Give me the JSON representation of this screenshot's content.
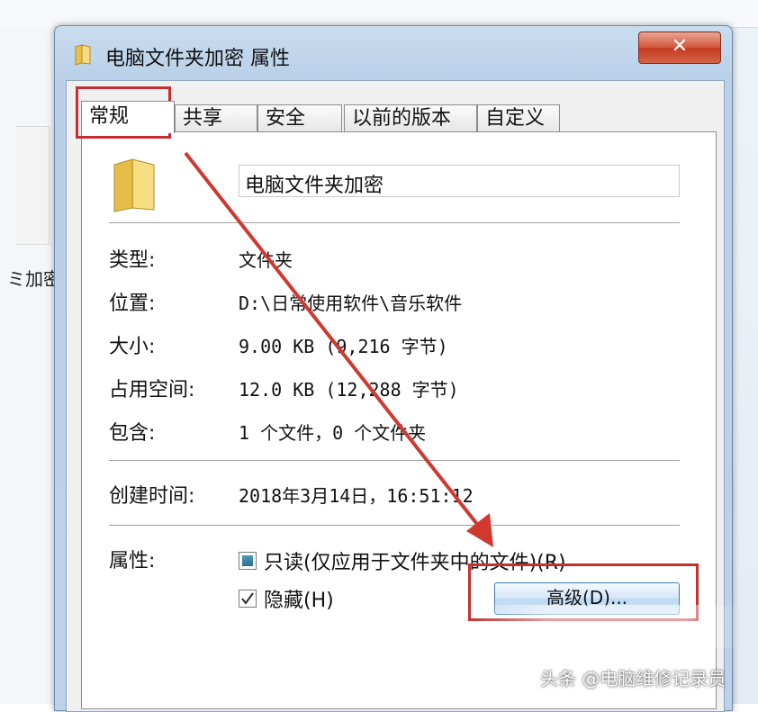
{
  "background": {
    "folder_label": "ミ加密"
  },
  "window": {
    "title": "电脑文件夹加密 属性",
    "close_label": "✕"
  },
  "tabs": [
    {
      "label": "常规",
      "active": true
    },
    {
      "label": "共享",
      "active": false
    },
    {
      "label": "安全",
      "active": false
    },
    {
      "label": "以前的版本",
      "active": false
    },
    {
      "label": "自定义",
      "active": false
    }
  ],
  "general": {
    "folder_name": "电脑文件夹加密",
    "rows": [
      {
        "label": "类型:",
        "value": "文件夹"
      },
      {
        "label": "位置:",
        "value": "D:\\日常使用软件\\音乐软件"
      },
      {
        "label": "大小:",
        "value": "9.00 KB (9,216 字节)"
      },
      {
        "label": "占用空间:",
        "value": "12.0 KB (12,288 字节)"
      },
      {
        "label": "包含:",
        "value": "1 个文件，0 个文件夹"
      }
    ],
    "created_label": "创建时间:",
    "created_value": "2018年3月14日，16:51:12",
    "attributes_label": "属性:",
    "readonly_label": "只读(仅应用于文件夹中的文件)(R)",
    "readonly_state": "indeterminate",
    "hidden_label": "隐藏(H)",
    "hidden_state": "checked",
    "advanced_button": "高级(D)..."
  },
  "annotation": {
    "highlight_color": "#c62f2f"
  },
  "footer": {
    "credit": "头条 @电脑维修记录员"
  },
  "icons": {
    "folder": "folder-icon",
    "close": "close-icon",
    "checkmark": "checkmark-icon"
  }
}
